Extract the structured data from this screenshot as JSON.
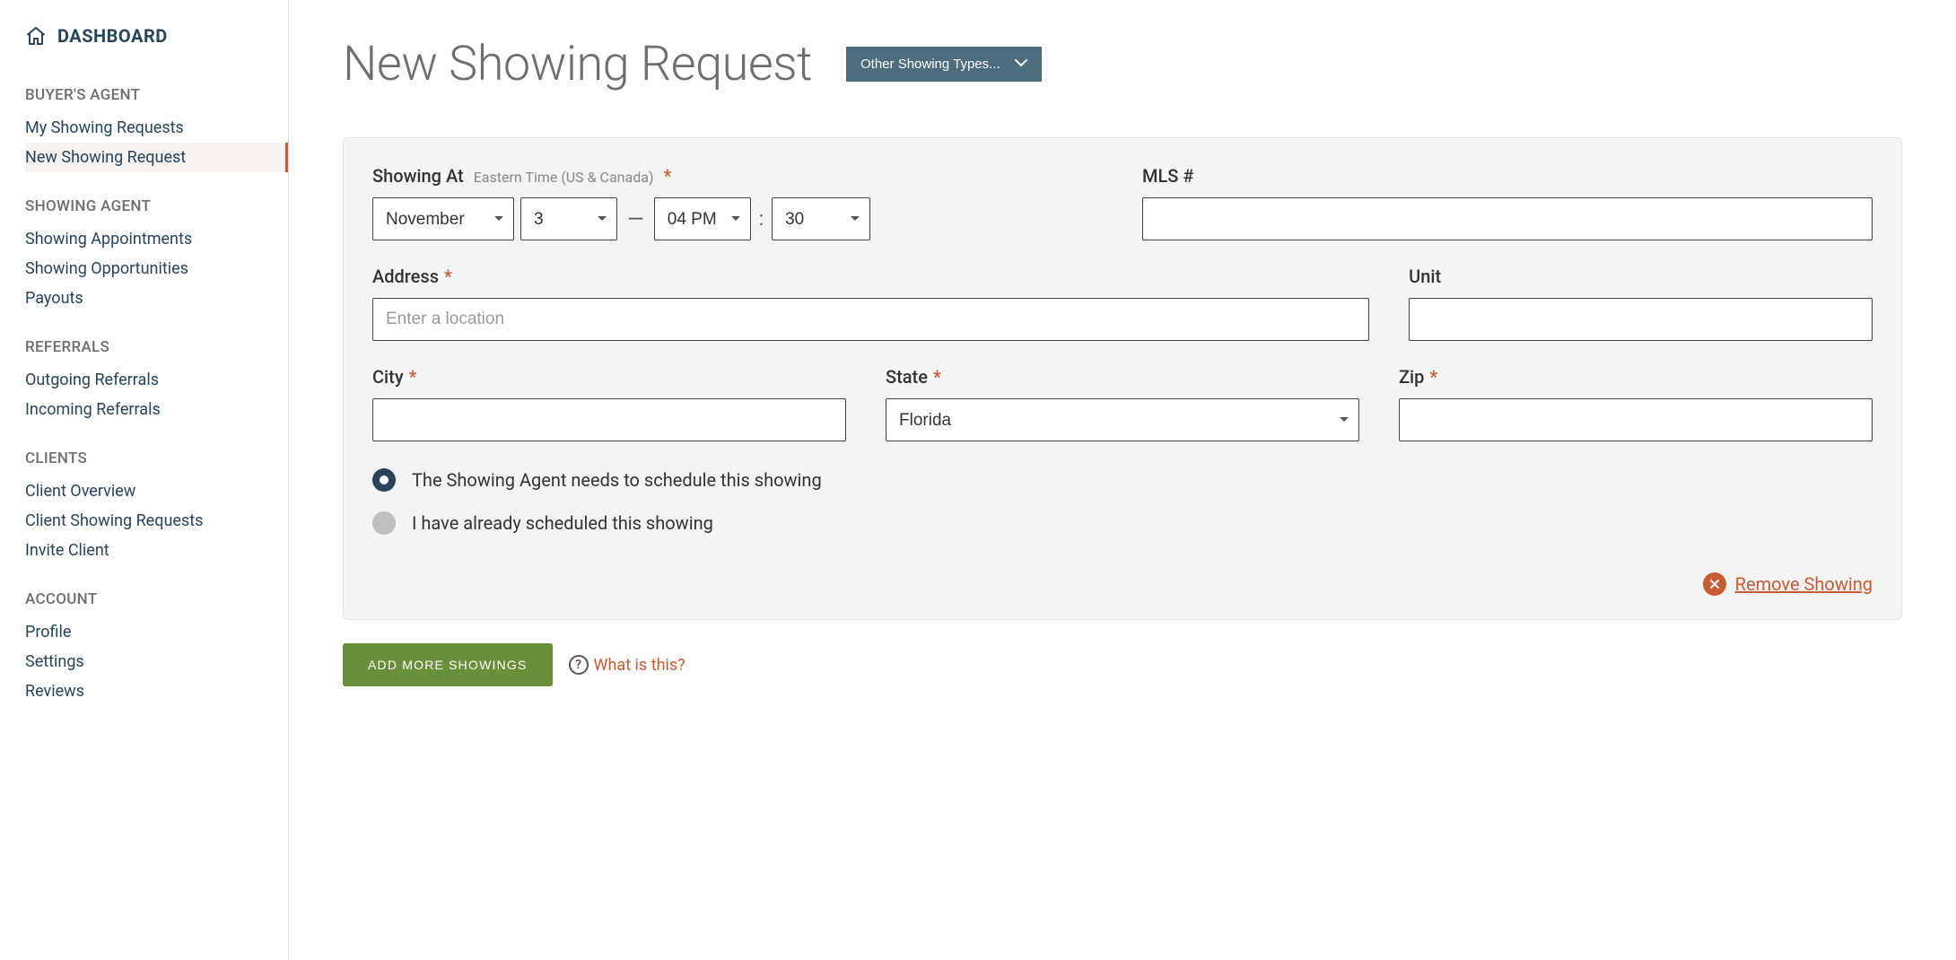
{
  "sidebar": {
    "dashboard_label": "DASHBOARD",
    "groups": [
      {
        "heading": "BUYER'S AGENT",
        "items": [
          {
            "label": "My Showing Requests",
            "active": false
          },
          {
            "label": "New Showing Request",
            "active": true
          }
        ]
      },
      {
        "heading": "SHOWING AGENT",
        "items": [
          {
            "label": "Showing Appointments"
          },
          {
            "label": "Showing Opportunities"
          },
          {
            "label": "Payouts"
          }
        ]
      },
      {
        "heading": "REFERRALS",
        "items": [
          {
            "label": "Outgoing Referrals"
          },
          {
            "label": "Incoming Referrals"
          }
        ]
      },
      {
        "heading": "CLIENTS",
        "items": [
          {
            "label": "Client Overview"
          },
          {
            "label": "Client Showing Requests"
          },
          {
            "label": "Invite Client"
          }
        ]
      },
      {
        "heading": "ACCOUNT",
        "items": [
          {
            "label": "Profile"
          },
          {
            "label": "Settings"
          },
          {
            "label": "Reviews"
          }
        ]
      }
    ]
  },
  "page": {
    "title": "New Showing Request",
    "other_types_label": "Other Showing Types..."
  },
  "form": {
    "showing_at": {
      "label": "Showing At",
      "tz": "Eastern Time (US & Canada)",
      "month": "November",
      "day": "3",
      "hour": "04 PM",
      "minute": "30"
    },
    "mls": {
      "label": "MLS #",
      "value": ""
    },
    "address": {
      "label": "Address",
      "placeholder": "Enter a location",
      "value": ""
    },
    "unit": {
      "label": "Unit",
      "value": ""
    },
    "city": {
      "label": "City",
      "value": ""
    },
    "state": {
      "label": "State",
      "value": "Florida"
    },
    "zip": {
      "label": "Zip",
      "value": ""
    },
    "radios": {
      "needs_schedule": "The Showing Agent needs to schedule this showing",
      "already_scheduled": "I have already scheduled this showing",
      "selected": "needs_schedule"
    },
    "remove_label": "Remove Showing",
    "add_more_label": "ADD MORE SHOWINGS",
    "what_is_this": "What is this?"
  }
}
